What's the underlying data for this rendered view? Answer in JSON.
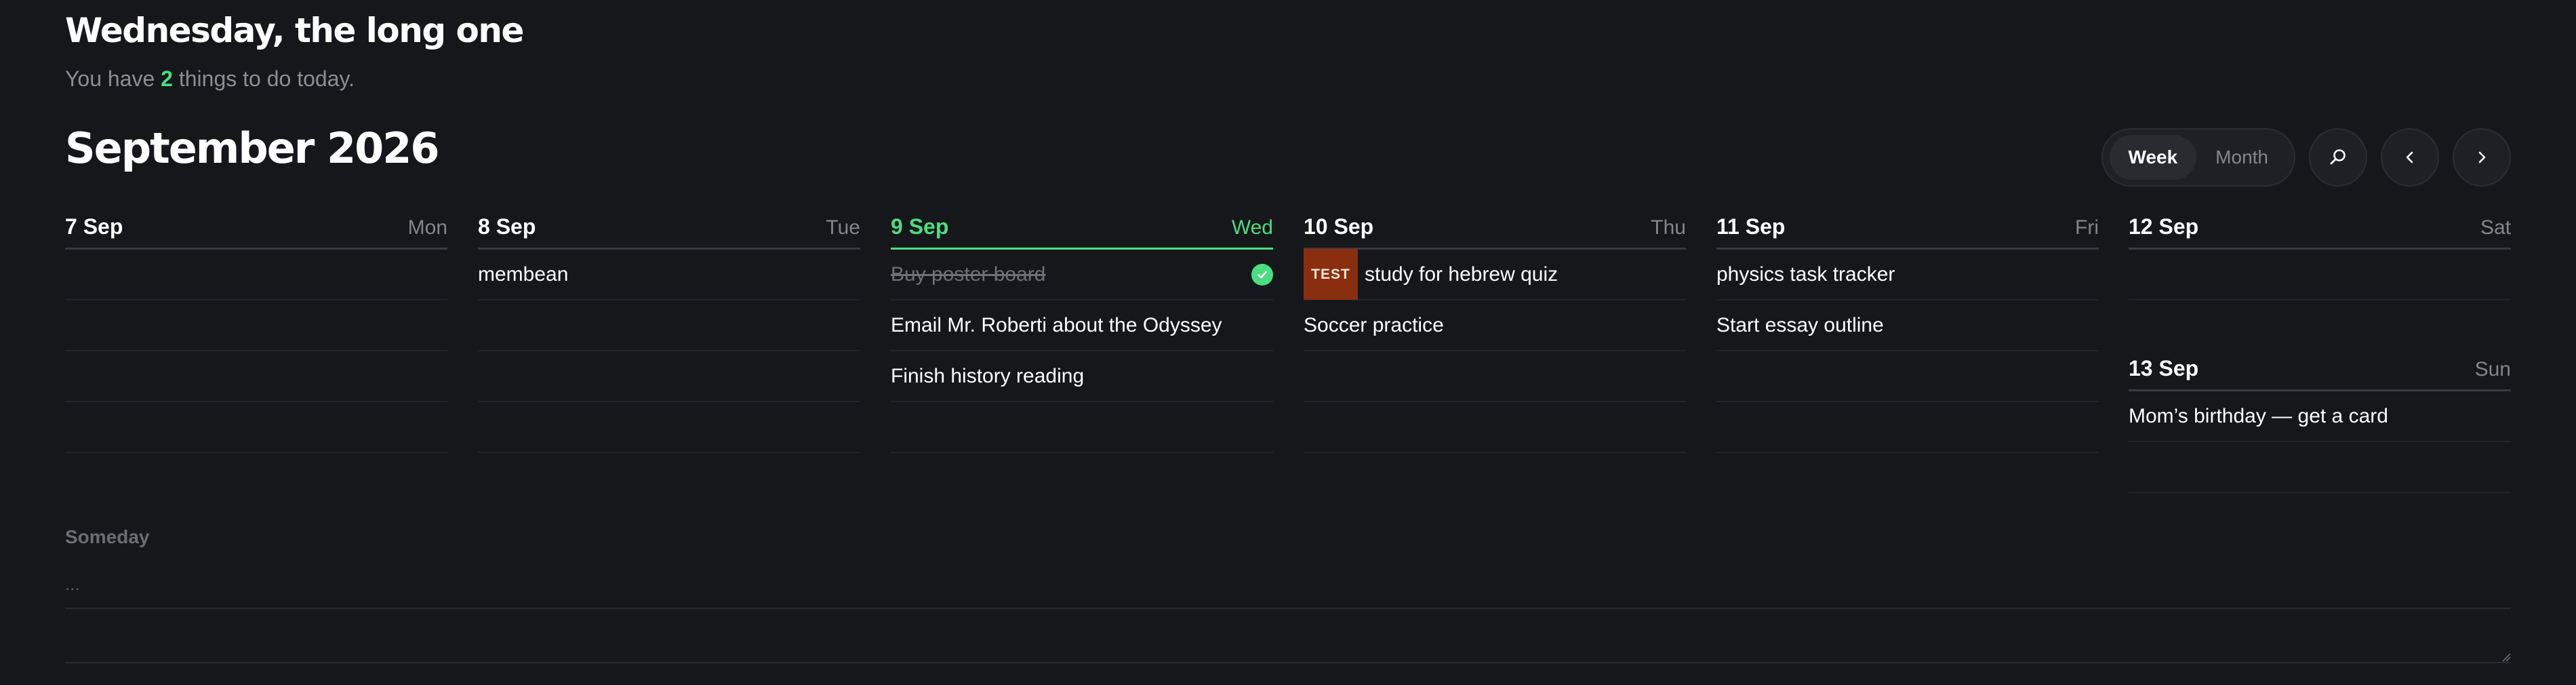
{
  "header": {
    "greeting": "Wednesday, the long one",
    "subtitle_prefix": "You have ",
    "subtitle_count": "2",
    "subtitle_suffix": " things to do today."
  },
  "calendar": {
    "title": "September 2026",
    "view_options": [
      "Week",
      "Month"
    ],
    "active_view": "Week",
    "search_icon": "search-icon",
    "prev_icon": "chevron-left-icon",
    "next_icon": "chevron-right-icon"
  },
  "colors": {
    "accent": "#4ade80",
    "background": "#16171b",
    "test_tag": "#8a2e10"
  },
  "days": [
    {
      "date": "7 Sep",
      "dow": "Mon",
      "today": false,
      "tasks": []
    },
    {
      "date": "8 Sep",
      "dow": "Tue",
      "today": false,
      "tasks": [
        {
          "text": "membean",
          "done": false
        }
      ]
    },
    {
      "date": "9 Sep",
      "dow": "Wed",
      "today": true,
      "tasks": [
        {
          "text": "Buy poster board",
          "done": true
        },
        {
          "text": "Email Mr. Roberti about the Odyssey",
          "done": false
        },
        {
          "text": "Finish history reading",
          "done": false
        }
      ]
    },
    {
      "date": "10 Sep",
      "dow": "Thu",
      "today": false,
      "tasks": [
        {
          "text": "study for hebrew quiz",
          "done": false,
          "tag": "TEST"
        },
        {
          "text": "Soccer practice",
          "done": false
        }
      ]
    },
    {
      "date": "11 Sep",
      "dow": "Fri",
      "today": false,
      "tasks": [
        {
          "text": "physics task tracker",
          "done": false
        },
        {
          "text": "Start essay outline",
          "done": false
        }
      ]
    },
    {
      "date": "12 Sep",
      "dow": "Sat",
      "today": false,
      "tasks": []
    },
    {
      "date": "13 Sep",
      "dow": "Sun",
      "today": false,
      "tasks": [
        {
          "text": "Mom’s birthday — get a card",
          "done": false
        }
      ]
    }
  ],
  "someday": {
    "label": "Someday",
    "placeholder": "..."
  }
}
